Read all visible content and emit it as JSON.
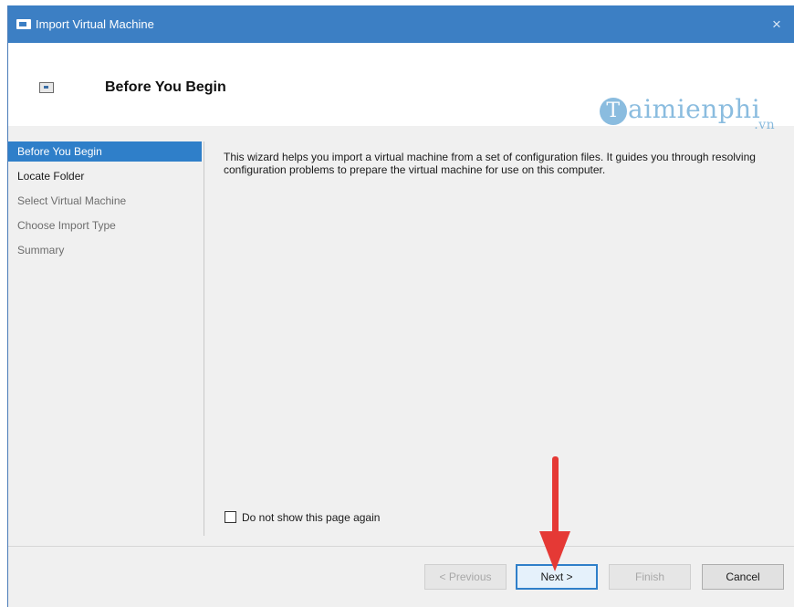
{
  "window": {
    "title": "Import Virtual Machine",
    "close_glyph": "×",
    "accent_color": "#3c7fc4"
  },
  "header": {
    "title": "Before You Begin"
  },
  "watermark": {
    "brand_initial": "T",
    "brand_rest": "aimienphi",
    "tld": ".vn"
  },
  "nav": {
    "items": [
      {
        "label": "Before You Begin",
        "state": "active"
      },
      {
        "label": "Locate Folder",
        "state": "next"
      },
      {
        "label": "Select Virtual Machine",
        "state": "inactive"
      },
      {
        "label": "Choose Import Type",
        "state": "inactive"
      },
      {
        "label": "Summary",
        "state": "inactive"
      }
    ]
  },
  "content": {
    "description": "This wizard helps you import a virtual machine from a set of configuration files. It guides you through resolving configuration problems to prepare the virtual machine for use on this computer.",
    "checkbox_label": "Do not show this page again",
    "checkbox_checked": false
  },
  "buttons": {
    "previous": "< Previous",
    "next": "Next >",
    "finish": "Finish",
    "cancel": "Cancel"
  },
  "annotation": {
    "arrow_color": "#e53935",
    "arrow_direction": "down"
  }
}
